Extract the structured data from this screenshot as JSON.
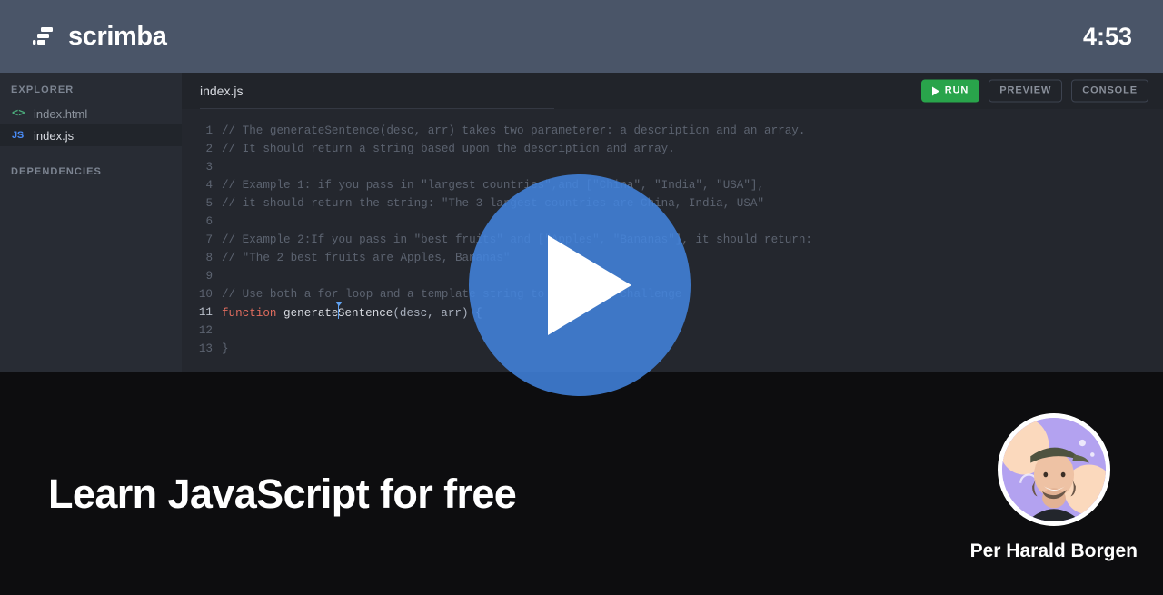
{
  "header": {
    "brand": "scrimba",
    "logo_icon": "scrimba-logo-icon",
    "timer": "4:53"
  },
  "sidebar": {
    "explorer_label": "EXPLORER",
    "dependencies_label": "DEPENDENCIES",
    "files": [
      {
        "name": "index.html",
        "icon": "html-code-icon",
        "icon_text": "<>",
        "active": false
      },
      {
        "name": "index.js",
        "icon": "js-file-icon",
        "icon_text": "JS",
        "active": true
      }
    ]
  },
  "editor": {
    "tab_label": "index.js",
    "toolbar": {
      "run_label": "RUN",
      "run_icon": "play-icon",
      "preview_label": "PREVIEW",
      "console_label": "CONSOLE"
    },
    "lines": [
      {
        "no": "1",
        "text": "// The generateSentence(desc, arr) takes two parameterer: a description and an array."
      },
      {
        "no": "2",
        "text": "// It should return a string based upon the description and array."
      },
      {
        "no": "3",
        "text": ""
      },
      {
        "no": "4",
        "text": "// Example 1: if you pass in \"largest countries\",and [\"China\", \"India\", \"USA\"],"
      },
      {
        "no": "5",
        "text": "// it should return the string: \"The 3 largest countries are China, India, USA\""
      },
      {
        "no": "6",
        "text": ""
      },
      {
        "no": "7",
        "text": "// Example 2:If you pass in \"best fruits\" and [\"Apples\", \"Bananas\"], it should return:"
      },
      {
        "no": "8",
        "text": "// \"The 2 best fruits are Apples, Bananas\""
      },
      {
        "no": "9",
        "text": ""
      },
      {
        "no": "10",
        "text": "// Use both a for loop and a template string to solve the challenge"
      },
      {
        "no": "11",
        "code": {
          "keyword": "function",
          "name_before_caret": " generate",
          "name_after_caret": "Sentence",
          "params": "(desc, arr) {"
        }
      },
      {
        "no": "12",
        "text": ""
      },
      {
        "no": "13",
        "text": "}"
      }
    ]
  },
  "overlay": {
    "play_icon": "play-button-icon",
    "accent_color": "#4285e0"
  },
  "promo": {
    "title": "Learn JavaScript for free",
    "author_name": "Per Harald Borgen",
    "avatar_icon": "author-avatar"
  }
}
